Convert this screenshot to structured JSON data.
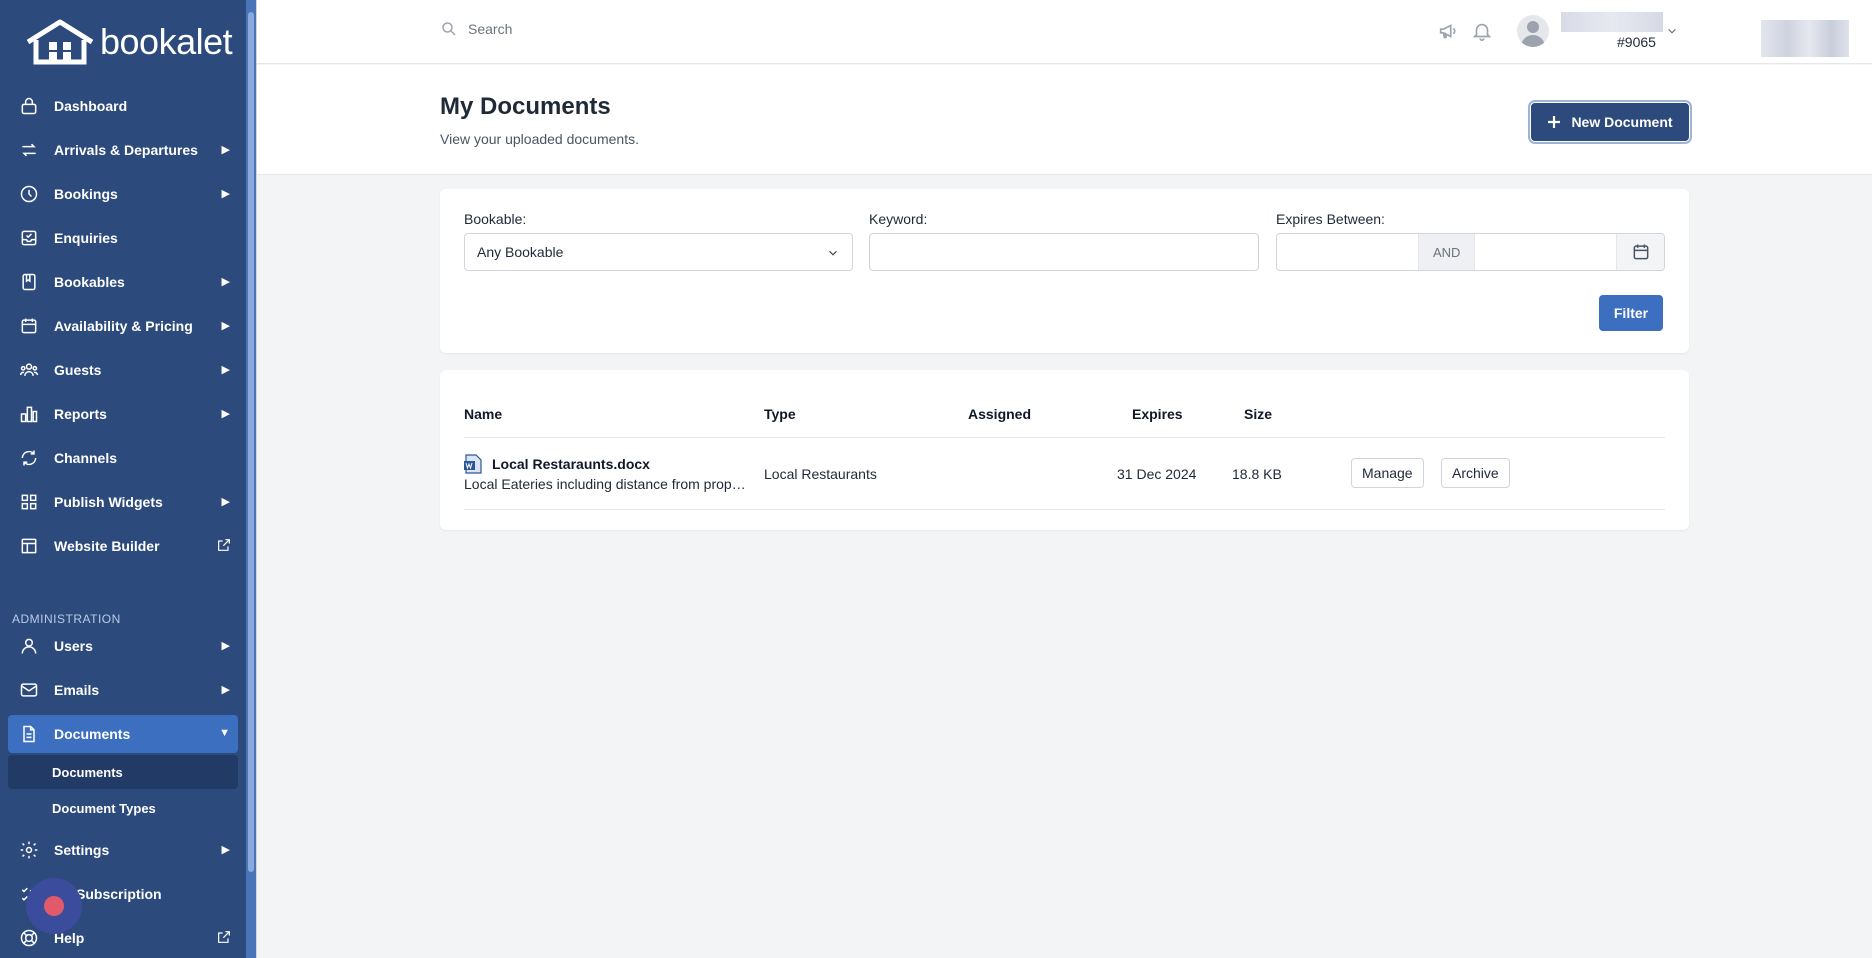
{
  "app": {
    "brand": "bookalet",
    "accent": "#2c4a7c",
    "accent_light": "#3d6fc0"
  },
  "topbar": {
    "search_placeholder": "Search",
    "user_id": "#9065"
  },
  "sidebar": {
    "items": [
      {
        "label": "Dashboard",
        "icon": "lock-icon"
      },
      {
        "label": "Arrivals & Departures",
        "icon": "swap-arrows-icon"
      },
      {
        "label": "Bookings",
        "icon": "clock-icon"
      },
      {
        "label": "Enquiries",
        "icon": "inbox-icon"
      },
      {
        "label": "Bookables",
        "icon": "book-icon"
      },
      {
        "label": "Availability & Pricing",
        "icon": "calendar-icon"
      },
      {
        "label": "Guests",
        "icon": "users-icon"
      },
      {
        "label": "Reports",
        "icon": "bar-chart-icon"
      },
      {
        "label": "Channels",
        "icon": "refresh-icon"
      },
      {
        "label": "Publish Widgets",
        "icon": "grid-icon"
      },
      {
        "label": "Website Builder",
        "icon": "layout-icon"
      }
    ],
    "admin_label": "ADMINISTRATION",
    "admin_items": [
      {
        "label": "Users",
        "icon": "user-icon"
      },
      {
        "label": "Emails",
        "icon": "mail-icon"
      },
      {
        "label": "Documents",
        "icon": "document-icon"
      }
    ],
    "sub_items": [
      {
        "label": "Documents"
      },
      {
        "label": "Document Types"
      }
    ],
    "bottom_items": [
      {
        "label": "Settings",
        "icon": "gear-icon"
      },
      {
        "label": "Subscription",
        "icon": "check-list-icon"
      },
      {
        "label": "Help",
        "icon": "lifebuoy-icon"
      }
    ]
  },
  "header": {
    "title": "My Documents",
    "subtitle": "View your uploaded documents.",
    "new_button": "New Document"
  },
  "filters": {
    "bookable_label": "Bookable:",
    "bookable_value": "Any Bookable",
    "keyword_label": "Keyword:",
    "keyword_value": "",
    "expires_label": "Expires Between:",
    "and_label": "AND",
    "filter_button": "Filter"
  },
  "table": {
    "columns": [
      "Name",
      "Type",
      "Assigned",
      "Expires",
      "Size"
    ],
    "rows": [
      {
        "name": "Local Restaraunts.docx",
        "description": "Local Eateries including distance from property",
        "type": "Local Restaurants",
        "assigned": "",
        "expires": "31 Dec 2024",
        "size": "18.8 KB",
        "manage": "Manage",
        "archive": "Archive"
      }
    ]
  }
}
